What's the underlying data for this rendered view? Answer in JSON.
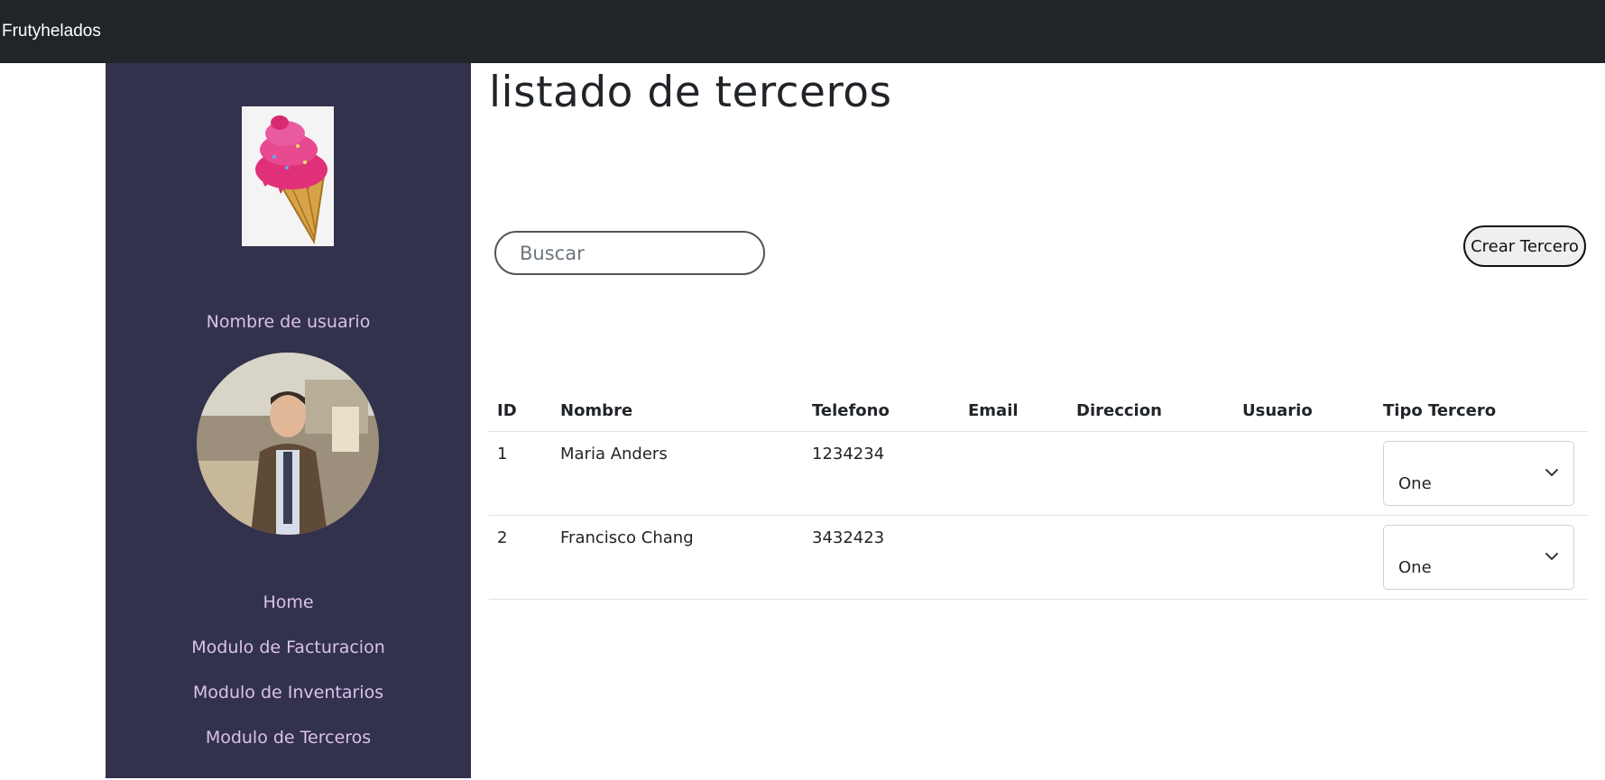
{
  "app": {
    "brand": "Frutyhelados"
  },
  "sidebar": {
    "username": "Nombre de usuario",
    "nav": [
      {
        "label": "Home"
      },
      {
        "label": "Modulo de Facturacion"
      },
      {
        "label": "Modulo de Inventarios"
      },
      {
        "label": "Modulo de Terceros"
      }
    ]
  },
  "main": {
    "title": "listado de terceros",
    "search": {
      "placeholder": "Buscar",
      "value": ""
    },
    "create_button": "Crear Tercero",
    "table": {
      "columns": [
        "ID",
        "Nombre",
        "Telefono",
        "Email",
        "Direccion",
        "Usuario",
        "Tipo Tercero"
      ],
      "rows": [
        {
          "id": "1",
          "nombre": "Maria Anders",
          "telefono": "1234234",
          "email": "",
          "direccion": "",
          "usuario": "",
          "tipo": "One"
        },
        {
          "id": "2",
          "nombre": "Francisco Chang",
          "telefono": "3432423",
          "email": "",
          "direccion": "",
          "usuario": "",
          "tipo": "One"
        }
      ]
    }
  },
  "colors": {
    "topbar": "#212529",
    "sidebar": "#32324c",
    "sidebar_text": "#dcc0ec"
  }
}
